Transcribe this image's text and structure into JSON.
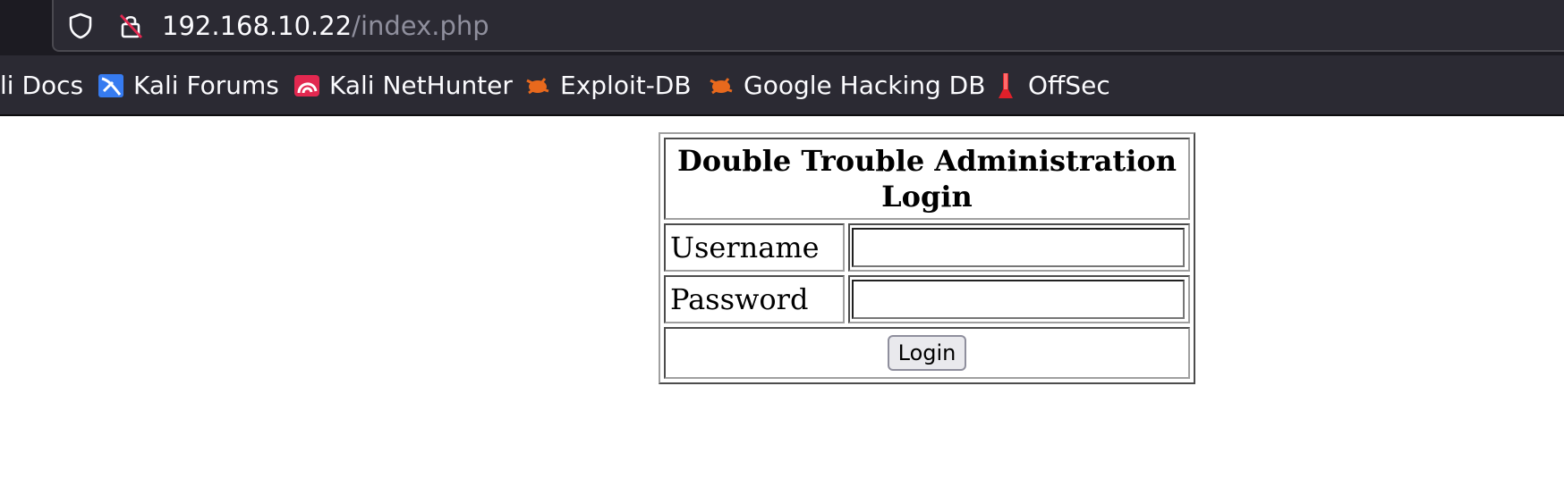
{
  "browser": {
    "url_host": "192.168.10.22",
    "url_path": "/index.php",
    "bookmarks": [
      {
        "label": "li Docs",
        "icon": "kali-docs-icon"
      },
      {
        "label": "Kali Forums",
        "icon": "kali-forums-icon"
      },
      {
        "label": "Kali NetHunter",
        "icon": "kali-nethunter-icon"
      },
      {
        "label": "Exploit-DB",
        "icon": "exploit-db-icon"
      },
      {
        "label": "Google Hacking DB",
        "icon": "google-hacking-db-icon"
      },
      {
        "label": "OffSec",
        "icon": "offsec-icon"
      }
    ],
    "colors": {
      "toolbar": "#2b2a33",
      "text": "#fbfbfe",
      "path": "#8f8f9d"
    }
  },
  "login": {
    "title": "Double Trouble Administration Login",
    "username_label": "Username",
    "password_label": "Password",
    "username_value": "",
    "password_value": "",
    "submit_label": "Login"
  }
}
